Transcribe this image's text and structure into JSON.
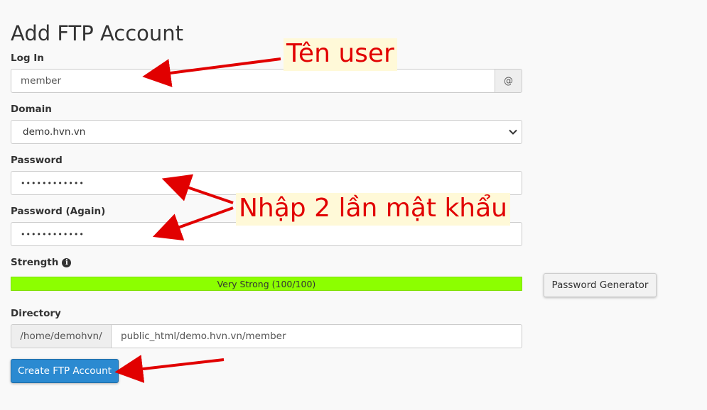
{
  "page": {
    "title": "Add FTP Account"
  },
  "login": {
    "label": "Log In",
    "value": "member",
    "addon": "@"
  },
  "domain": {
    "label": "Domain",
    "selected": "demo.hvn.vn"
  },
  "password": {
    "label": "Password",
    "masked": "••••••••••••"
  },
  "password_again": {
    "label": "Password (Again)",
    "masked": "••••••••••••"
  },
  "strength": {
    "label": "Strength",
    "text": "Very Strong (100/100)",
    "percent": 100,
    "color": "#8cff00"
  },
  "buttons": {
    "password_generator": "Password Generator",
    "create": "Create FTP Account"
  },
  "directory": {
    "label": "Directory",
    "prefix": "/home/demohvn/",
    "value": "public_html/demo.hvn.vn/member"
  },
  "annotations": {
    "user": "Tên user",
    "password": "Nhập 2 lần mật khẩu"
  },
  "colors": {
    "primary": "#2b8ad1",
    "annotation": "#e10000"
  }
}
